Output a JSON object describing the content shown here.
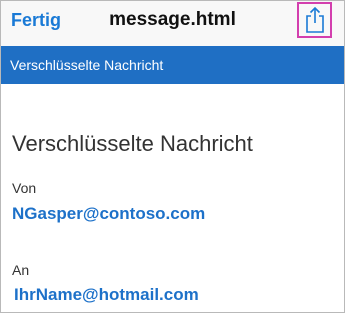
{
  "nav": {
    "done_label": "Fertig",
    "title": "message.html",
    "share_icon": "share-icon"
  },
  "banner": {
    "text": "Verschlüsselte Nachricht"
  },
  "message": {
    "heading": "Verschlüsselte Nachricht",
    "from_label": "Von",
    "from_address": "NGasper@contoso.com",
    "to_label": "An",
    "to_address": "IhrName@hotmail.com"
  },
  "colors": {
    "accent": "#1a7ad6",
    "banner": "#1f6fc4",
    "highlight": "#d33fae"
  }
}
